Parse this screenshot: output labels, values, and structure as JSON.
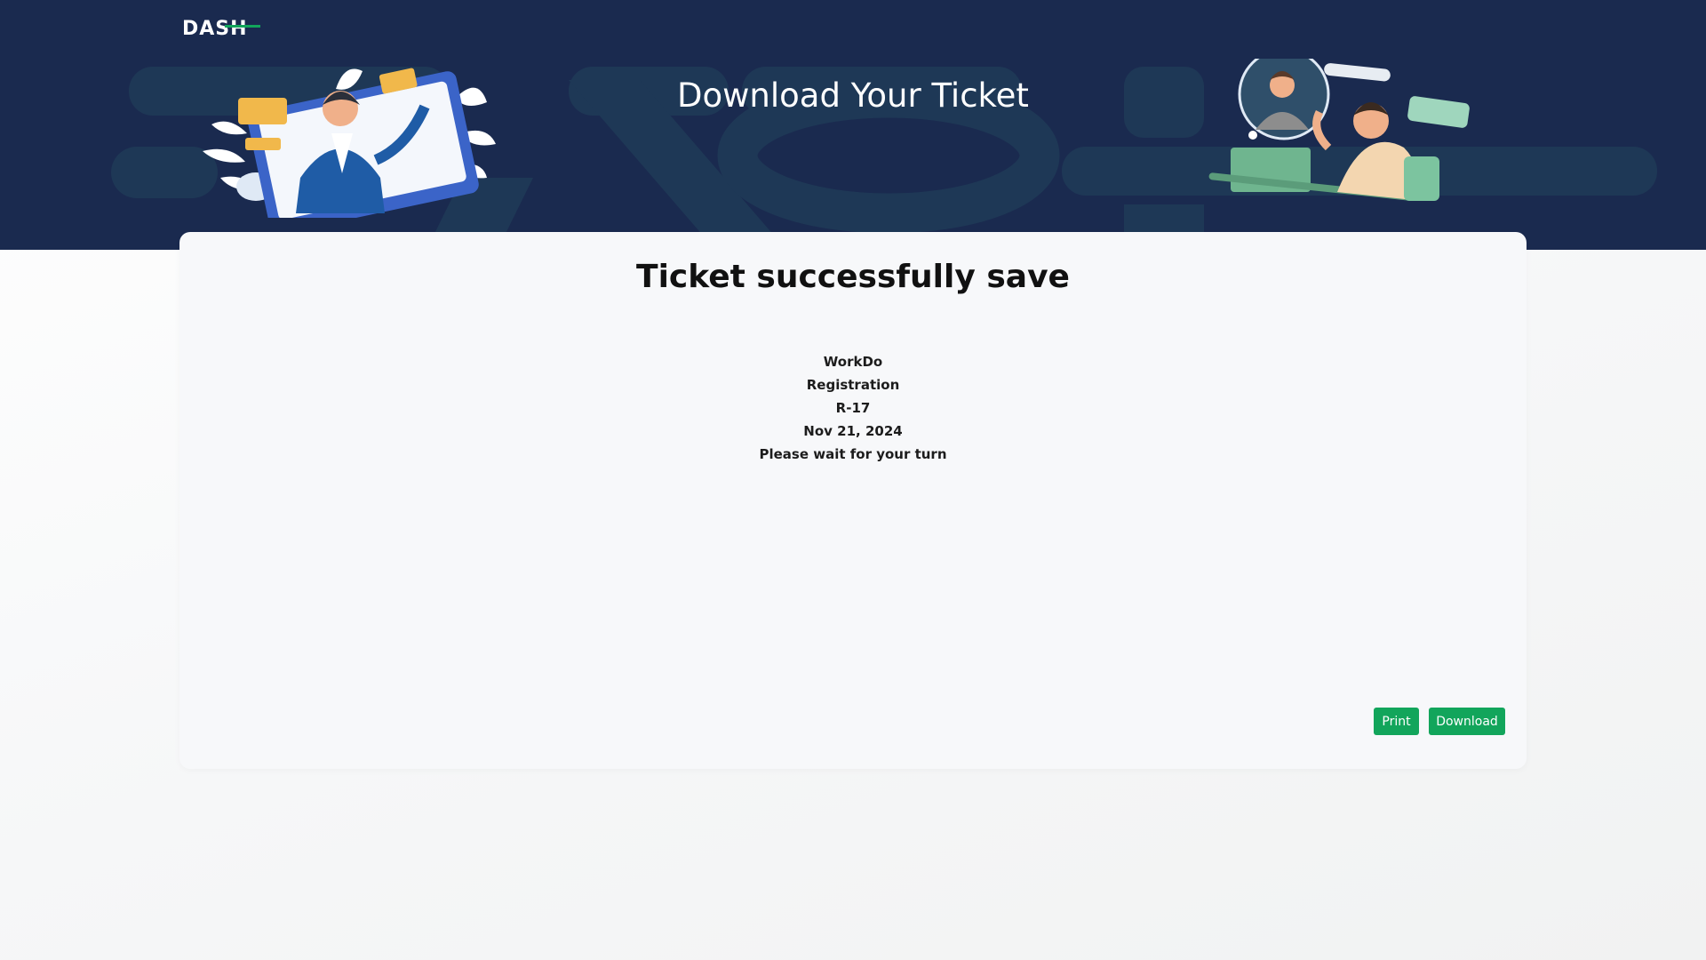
{
  "app": {
    "logo_text": "DASH"
  },
  "banner": {
    "title": "Download Your Ticket"
  },
  "ticket": {
    "heading": "Ticket successfully save",
    "lines": [
      "WorkDo",
      "Registration",
      "R-17",
      "Nov 21, 2024",
      "Please wait for your turn"
    ]
  },
  "actions": {
    "print_label": "Print",
    "download_label": "Download"
  },
  "colors": {
    "banner": "#1a2a4f",
    "accent": "#12a55b",
    "card": "#f7f8fa"
  },
  "icons": [
    "dash-logo-icon",
    "support-agent-illustration-icon",
    "customer-support-illustration-icon"
  ]
}
